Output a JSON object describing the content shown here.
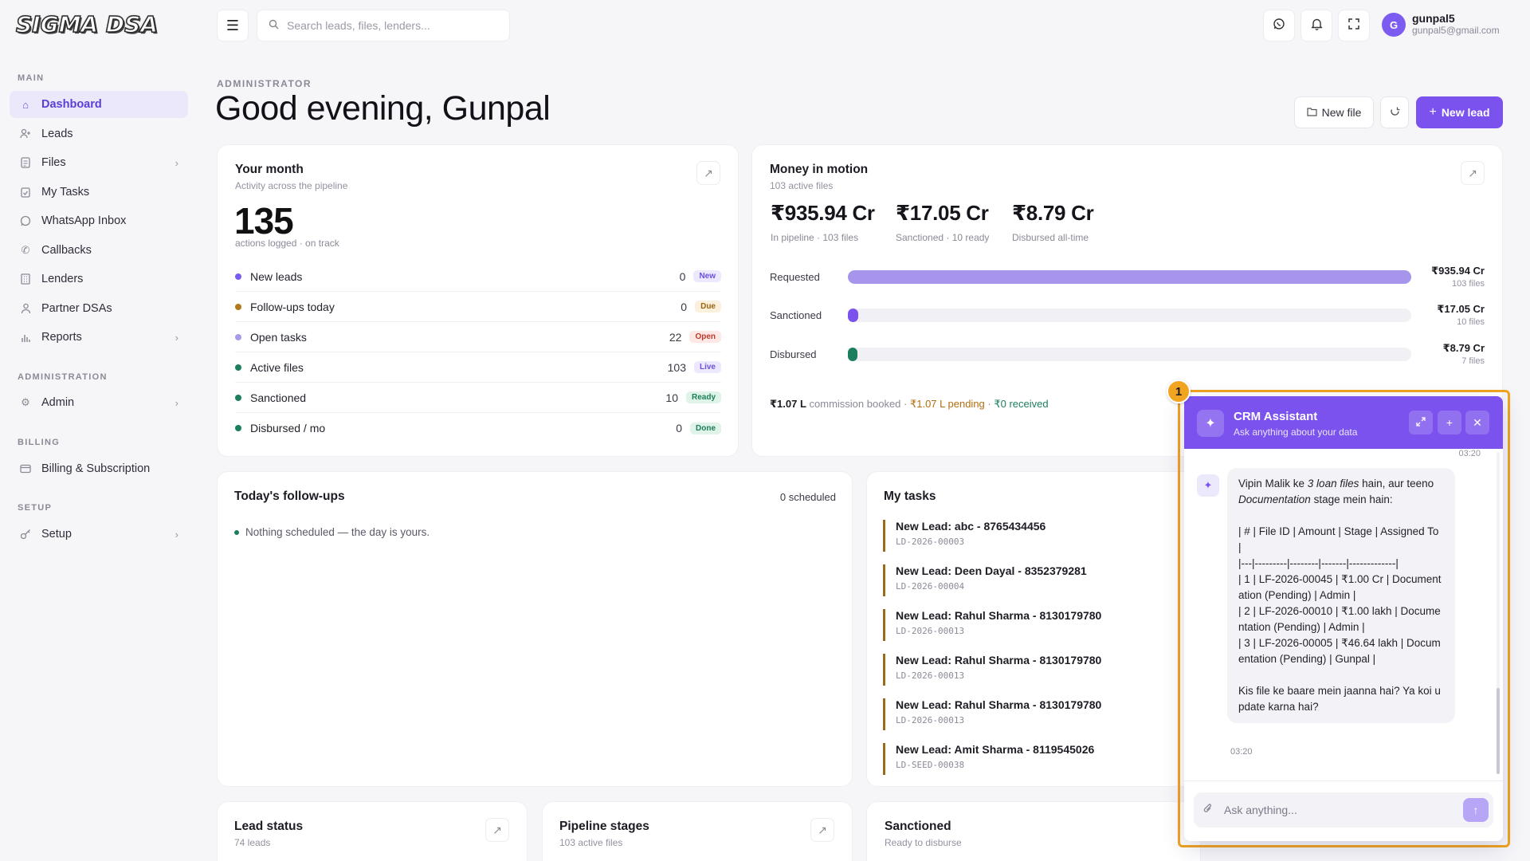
{
  "app": {
    "logo": "SIGMA DSA"
  },
  "sidebar": {
    "sections": {
      "main": "MAIN",
      "administration": "ADMINISTRATION",
      "billing": "BILLING",
      "setup": "SETUP"
    },
    "items": [
      {
        "label": "Dashboard"
      },
      {
        "label": "Leads"
      },
      {
        "label": "Files"
      },
      {
        "label": "My Tasks"
      },
      {
        "label": "WhatsApp Inbox"
      },
      {
        "label": "Callbacks"
      },
      {
        "label": "Lenders"
      },
      {
        "label": "Partner DSAs"
      },
      {
        "label": "Reports"
      },
      {
        "label": "Admin"
      },
      {
        "label": "Billing & Subscription"
      },
      {
        "label": "Setup"
      }
    ]
  },
  "topbar": {
    "search_placeholder": "Search leads, files, lenders...",
    "user": {
      "initial": "G",
      "name": "gunpal5",
      "email": "gunpal5@gmail.com"
    }
  },
  "header": {
    "role": "ADMINISTRATOR",
    "greeting": "Good evening, Gunpal",
    "new_file": "New file",
    "new_lead": "New lead"
  },
  "your_month": {
    "title": "Your month",
    "subtitle": "Activity across the pipeline",
    "total": "135",
    "total_sub": "actions logged · on track",
    "rows": [
      {
        "label": "New leads",
        "value": "0",
        "badge": "New",
        "dot": "#7c5cf0",
        "badge_bg": "#ece8fd",
        "badge_fg": "#6b4fe0"
      },
      {
        "label": "Follow-ups today",
        "value": "0",
        "badge": "Due",
        "dot": "#b07a1c",
        "badge_bg": "#fbf0dc",
        "badge_fg": "#9a6412"
      },
      {
        "label": "Open tasks",
        "value": "22",
        "badge": "Open",
        "dot": "#a99be8",
        "badge_bg": "#fde8e6",
        "badge_fg": "#c0392b"
      },
      {
        "label": "Active files",
        "value": "103",
        "badge": "Live",
        "dot": "#1c7f5b",
        "badge_bg": "#ede8fd",
        "badge_fg": "#6b4fe0"
      },
      {
        "label": "Sanctioned",
        "value": "10",
        "badge": "Ready",
        "dot": "#1c7f5b",
        "badge_bg": "#dff3e8",
        "badge_fg": "#1c7f5b"
      },
      {
        "label": "Disbursed / mo",
        "value": "0",
        "badge": "Done",
        "dot": "#1c7f5b",
        "badge_bg": "#dff3e8",
        "badge_fg": "#1c7f5b"
      }
    ]
  },
  "money": {
    "title": "Money in motion",
    "subtitle": "103 active files",
    "totals": [
      {
        "value": "₹935.94 Cr",
        "label": "In pipeline · 103 files"
      },
      {
        "value": "₹17.05 Cr",
        "label": "Sanctioned · 10 ready"
      },
      {
        "value": "₹8.79 Cr",
        "label": "Disbursed all-time"
      }
    ],
    "bars": [
      {
        "label": "Requested",
        "amount": "₹935.94 Cr",
        "files": "103 files",
        "fraction": 1.0,
        "color": "#a795ec"
      },
      {
        "label": "Sanctioned",
        "amount": "₹17.05 Cr",
        "files": "10 files",
        "fraction": 0.0182,
        "color": "#7b52ee"
      },
      {
        "label": "Disbursed",
        "amount": "₹8.79 Cr",
        "files": "7 files",
        "fraction": 0.0094,
        "color": "#1c7f5b"
      }
    ],
    "commission": {
      "booked_value": "₹1.07 L",
      "booked_text": " commission booked · ",
      "pending": "₹1.07 L pending",
      "sep": " · ",
      "received": "₹0 received"
    }
  },
  "followups": {
    "title": "Today's follow-ups",
    "count": "0 scheduled",
    "empty": "Nothing scheduled — the day is yours."
  },
  "tasks": {
    "title": "My tasks",
    "items": [
      {
        "title": "New Lead: abc - 8765434456",
        "id": "LD-2026-00003"
      },
      {
        "title": "New Lead: Deen Dayal - 8352379281",
        "id": "LD-2026-00004"
      },
      {
        "title": "New Lead: Rahul Sharma - 8130179780",
        "id": "LD-2026-00013"
      },
      {
        "title": "New Lead: Rahul Sharma - 8130179780",
        "id": "LD-2026-00013"
      },
      {
        "title": "New Lead: Rahul Sharma - 8130179780",
        "id": "LD-2026-00013"
      },
      {
        "title": "New Lead: Amit Sharma - 8119545026",
        "id": "LD-SEED-00038"
      }
    ]
  },
  "bottom_cards": [
    {
      "title": "Lead status",
      "subtitle": "74 leads"
    },
    {
      "title": "Pipeline stages",
      "subtitle": "103 active files"
    },
    {
      "title": "Sanctioned",
      "subtitle": "Ready to disburse"
    }
  ],
  "chat": {
    "marker": "1",
    "title": "CRM Assistant",
    "subtitle": "Ask anything about your data",
    "time_top": "03:20",
    "message": {
      "intro_a": "Vipin Malik ke ",
      "intro_em1": "3 loan files",
      "intro_b": " hain, aur teeno ",
      "intro_em2": "Documentation",
      "intro_c": " stage mein hain:",
      "table": "| # | File ID | Amount | Stage | Assigned To |\n|---|---------|--------|-------|-------------|\n| 1 | LF-2026-00045 | ₹1.00 Cr | Documentation (Pending) | Admin |\n| 2 | LF-2026-00010 | ₹1.00 lakh | Documentation (Pending) | Admin |\n| 3 | LF-2026-00005 | ₹46.64 lakh | Documentation (Pending) | Gunpal |",
      "outro": "Kis file ke baare mein jaanna hai? Ya koi update karna hai?"
    },
    "time_bottom": "03:20",
    "input_placeholder": "Ask anything..."
  }
}
